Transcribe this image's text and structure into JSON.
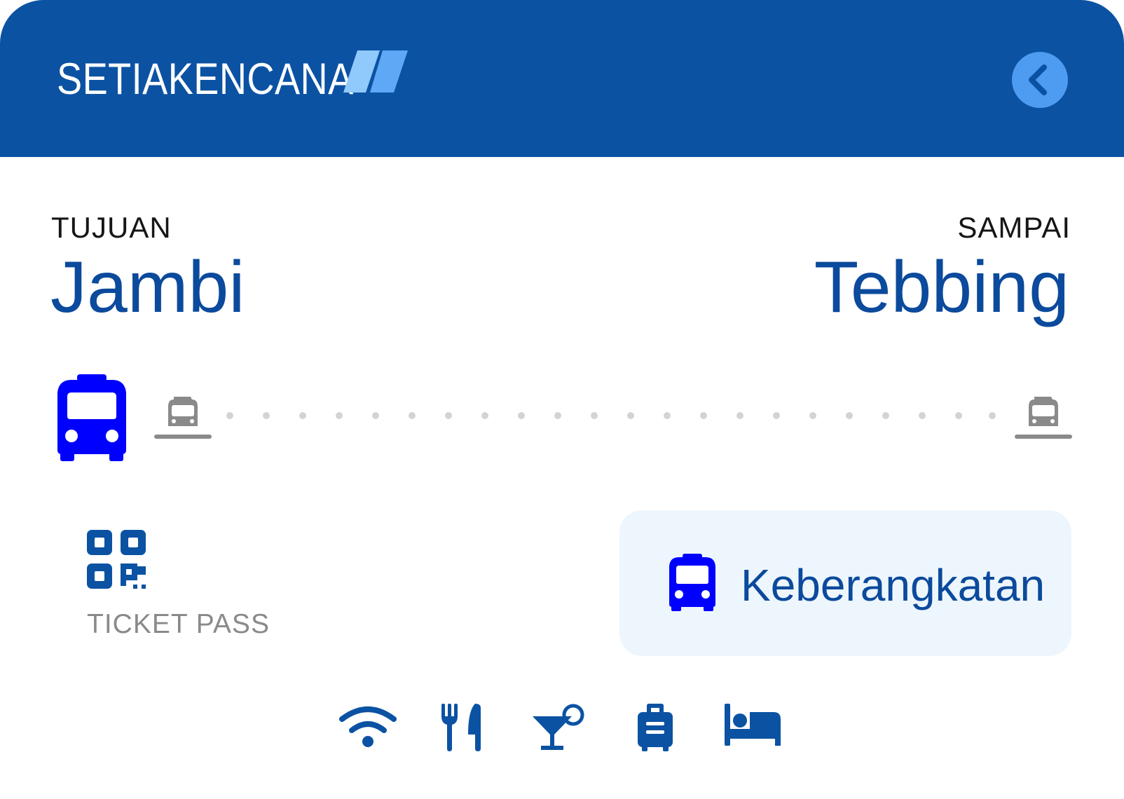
{
  "header": {
    "brand": "SETIAKENCANA",
    "back_icon": "chevron-left-icon"
  },
  "route": {
    "from_label": "TUJUAN",
    "from_city": "Jambi",
    "to_label": "SAMPAI",
    "to_city": "Tebbing"
  },
  "ticket_pass": {
    "label": "TICKET PASS",
    "icon": "qr-code-icon"
  },
  "departure": {
    "label": "Keberangkatan",
    "icon": "bus-icon"
  },
  "facilities": [
    "wifi-icon",
    "restaurant-icon",
    "bar-icon",
    "luggage-icon",
    "bed-icon"
  ],
  "colors": {
    "primary": "#0b52a3",
    "accent": "#4d9cf1",
    "bus": "#0000ff",
    "text_blue": "#0b4a9c",
    "muted": "#8a8a8a",
    "button_bg": "#eef6fd"
  }
}
